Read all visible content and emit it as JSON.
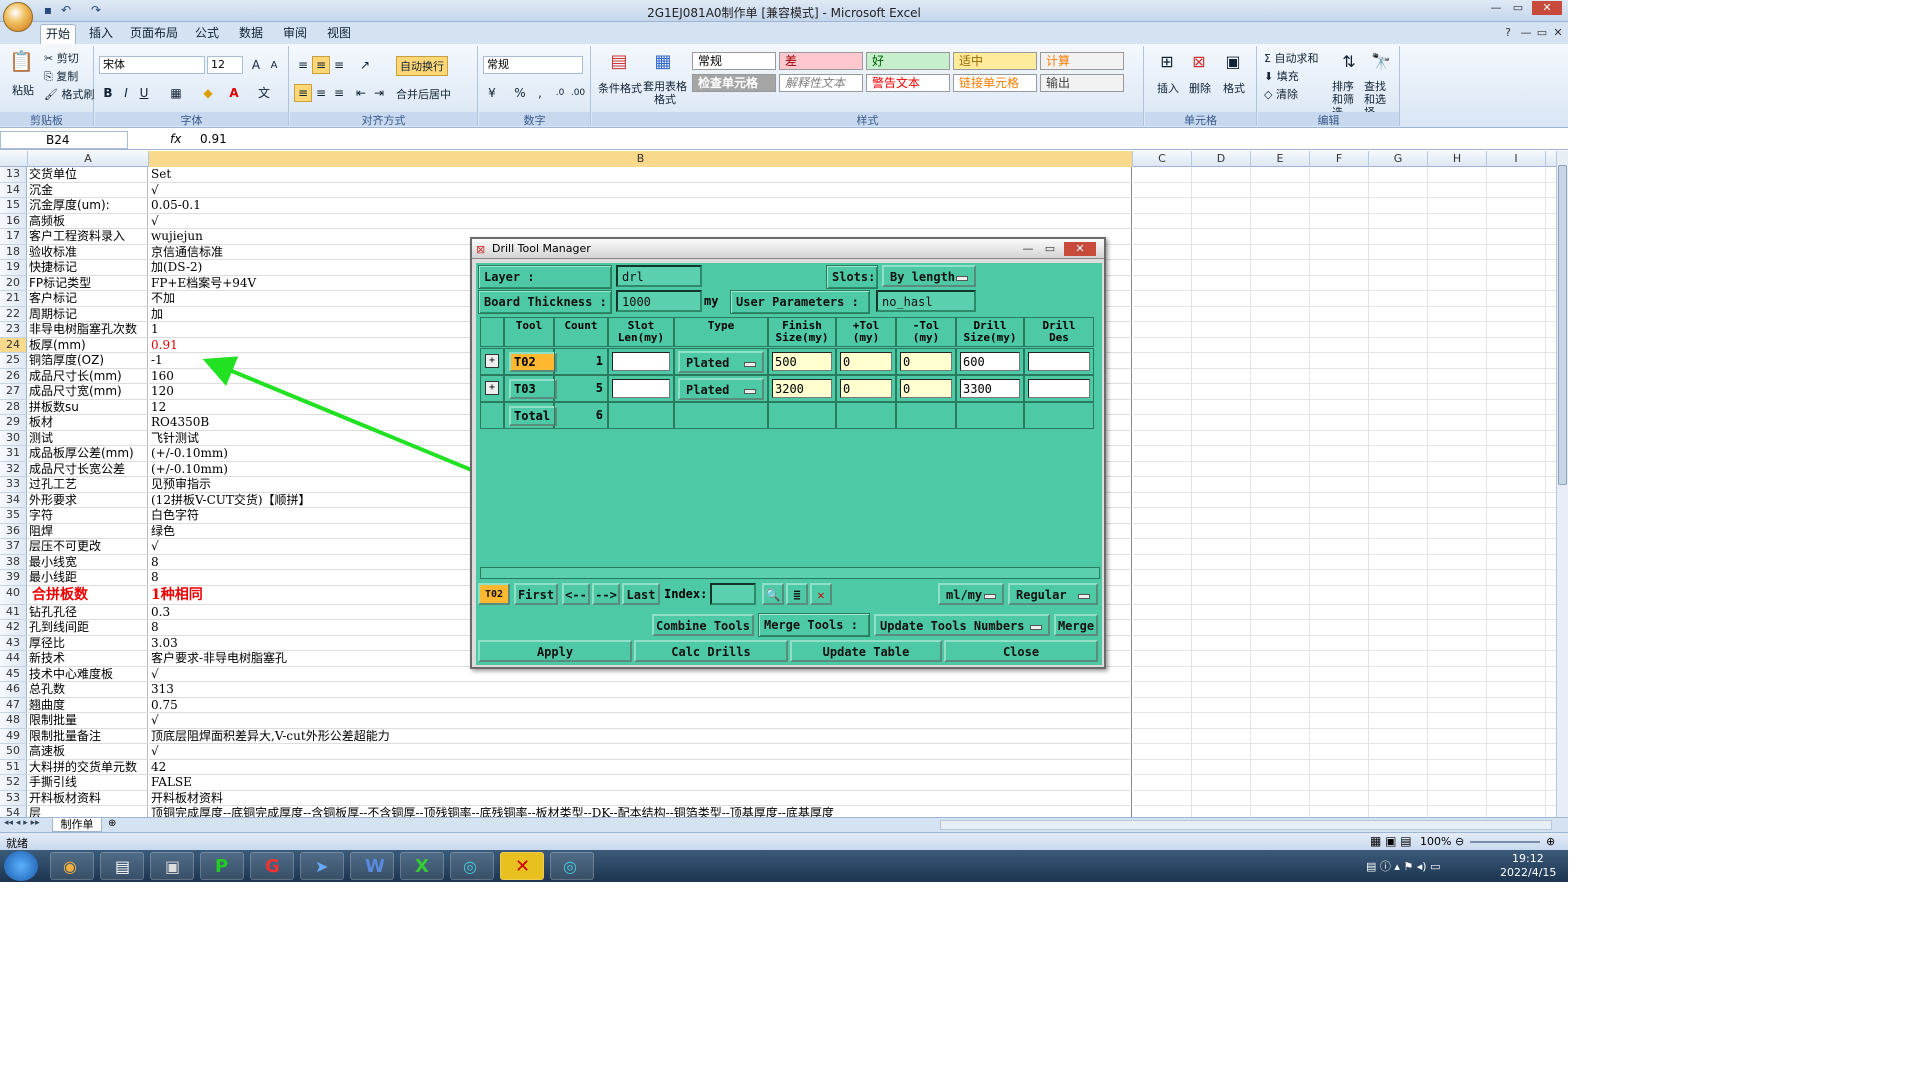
{
  "window": {
    "title": "2G1EJ081A0制作单  [兼容模式] - Microsoft Excel"
  },
  "ribbon": {
    "tabs": [
      "开始",
      "插入",
      "页面布局",
      "公式",
      "数据",
      "审阅",
      "视图"
    ],
    "clipboard": {
      "paste": "粘贴",
      "cut": "剪切",
      "copy": "复制",
      "format_painter": "格式刷",
      "label": "剪贴板"
    },
    "font": {
      "name": "宋体",
      "size": "12",
      "bold": "B",
      "italic": "I",
      "underline": "U",
      "label": "字体"
    },
    "alignment": {
      "wrap": "自动换行",
      "merge": "合并后居中",
      "label": "对齐方式"
    },
    "number": {
      "format": "常规",
      "percent": "%",
      "comma": ",",
      "label": "数字"
    },
    "styles": {
      "conditional": "条件格式",
      "table_format": "套用表格格式",
      "cells": [
        {
          "text": "常规",
          "bg": "#ffffff",
          "color": "#000000"
        },
        {
          "text": "差",
          "bg": "#ffc7ce",
          "color": "#9c0006"
        },
        {
          "text": "好",
          "bg": "#c6efce",
          "color": "#006100"
        },
        {
          "text": "适中",
          "bg": "#ffeb9c",
          "color": "#9c6500"
        },
        {
          "text": "计算",
          "bg": "#f2f2f2",
          "color": "#fa7d00"
        },
        {
          "text": "检查单元格",
          "bg": "#a5a5a5",
          "color": "#ffffff"
        },
        {
          "text": "解释性文本",
          "bg": "#ffffff",
          "color": "#7f7f7f"
        },
        {
          "text": "警告文本",
          "bg": "#ffffff",
          "color": "#ff0000"
        },
        {
          "text": "链接单元格",
          "bg": "#ffffff",
          "color": "#fa7d00"
        },
        {
          "text": "输出",
          "bg": "#f2f2f2",
          "color": "#3f3f3f"
        }
      ],
      "label": "样式"
    },
    "cells_group": {
      "insert": "插入",
      "delete": "删除",
      "format": "格式",
      "label": "单元格"
    },
    "editing": {
      "autosum": "自动求和",
      "fill": "填充",
      "clear": "清除",
      "sort": "排序和筛选",
      "find": "查找和选择",
      "label": "编辑"
    }
  },
  "formula_bar": {
    "name_box": "B24",
    "fx": "fx",
    "value": "0.91"
  },
  "columns": [
    "A",
    "B",
    "C",
    "D",
    "E",
    "F",
    "G",
    "H",
    "I"
  ],
  "rows": [
    {
      "n": "13",
      "a": "交货单位",
      "b": "Set"
    },
    {
      "n": "14",
      "a": "沉金",
      "b": "√"
    },
    {
      "n": "15",
      "a": "沉金厚度(um):",
      "b": "0.05-0.1"
    },
    {
      "n": "16",
      "a": "高频板",
      "b": "√"
    },
    {
      "n": "17",
      "a": "客户工程资料录入",
      "b": "wujiejun"
    },
    {
      "n": "18",
      "a": "验收标准",
      "b": "京信通信标准"
    },
    {
      "n": "19",
      "a": "快捷标记",
      "b": "加(DS-2)"
    },
    {
      "n": "20",
      "a": "FP标记类型",
      "b": "FP+E档案号+94V"
    },
    {
      "n": "21",
      "a": "客户标记",
      "b": "不加"
    },
    {
      "n": "22",
      "a": "周期标记",
      "b": "加"
    },
    {
      "n": "23",
      "a": "非导电树脂塞孔次数",
      "b": "1"
    },
    {
      "n": "24",
      "a": "板厚(mm)",
      "b": "0.91",
      "style": "red"
    },
    {
      "n": "25",
      "a": "铜箔厚度(OZ)",
      "b": "-1"
    },
    {
      "n": "26",
      "a": "成品尺寸长(mm)",
      "b": "160"
    },
    {
      "n": "27",
      "a": "成品尺寸宽(mm)",
      "b": "120"
    },
    {
      "n": "28",
      "a": "拼板数su",
      "b": "12"
    },
    {
      "n": "29",
      "a": "板材",
      "b": "RO4350B"
    },
    {
      "n": "30",
      "a": "测试",
      "b": "飞针测试"
    },
    {
      "n": "31",
      "a": "成品板厚公差(mm)",
      "b": "(+/-0.10mm)"
    },
    {
      "n": "32",
      "a": "成品尺寸长宽公差",
      "b": "(+/-0.10mm)"
    },
    {
      "n": "33",
      "a": "过孔工艺",
      "b": "见预审指示"
    },
    {
      "n": "34",
      "a": "外形要求",
      "b": "(12拼板V-CUT交货)【顺拼】"
    },
    {
      "n": "35",
      "a": "字符",
      "b": "白色字符"
    },
    {
      "n": "36",
      "a": "阻焊",
      "b": "绿色"
    },
    {
      "n": "37",
      "a": "层压不可更改",
      "b": "√"
    },
    {
      "n": "38",
      "a": "最小线宽",
      "b": "8"
    },
    {
      "n": "39",
      "a": "最小线距",
      "b": "8"
    },
    {
      "n": "40",
      "a": "合拼板数",
      "b": "1种相同",
      "style": "bigred"
    },
    {
      "n": "41",
      "a": "钻孔孔径",
      "b": "0.3"
    },
    {
      "n": "42",
      "a": "孔到线间距",
      "b": "8"
    },
    {
      "n": "43",
      "a": "厚径比",
      "b": "3.03"
    },
    {
      "n": "44",
      "a": "新技术",
      "b": "客户要求-非导电树脂塞孔"
    },
    {
      "n": "45",
      "a": "技术中心难度板",
      "b": "√"
    },
    {
      "n": "46",
      "a": "总孔数",
      "b": "313"
    },
    {
      "n": "47",
      "a": "翘曲度",
      "b": "0.75"
    },
    {
      "n": "48",
      "a": "限制批量",
      "b": "√"
    },
    {
      "n": "49",
      "a": "限制批量备注",
      "b": "顶底层阻焊面积差异大,V-cut外形公差超能力"
    },
    {
      "n": "50",
      "a": "高速板",
      "b": "√"
    },
    {
      "n": "51",
      "a": "大料拼的交货单元数",
      "b": "42"
    },
    {
      "n": "52",
      "a": "手撕引线",
      "b": "FALSE"
    },
    {
      "n": "53",
      "a": "开料板材资料",
      "b": "开料板材资料"
    },
    {
      "n": "54",
      "a": "层",
      "b": "顶铜完成厚度--底铜完成厚度--含铜板厚--不含铜厚--顶残铜率--底残铜率--板材类型--DK--配本结构--铜箔类型--顶基厚度--底基厚度"
    }
  ],
  "sheet_tab": "制作单",
  "status": {
    "ready": "就绪",
    "zoom": "100%"
  },
  "taskbar": {
    "time": "19:12",
    "date": "2022/4/15"
  },
  "dialog": {
    "title": "Drill Tool Manager",
    "layer_label": "Layer           :",
    "layer_value": "drl",
    "slots_label": "Slots:",
    "slots_value": "By length",
    "thickness_label": "Board Thickness :",
    "thickness_value": "1000",
    "thickness_unit": "my",
    "user_params_label": "User Parameters :",
    "user_params_value": "no_hasl",
    "headers": [
      "Tool",
      "Count",
      "Slot\nLen(my)",
      "Type",
      "Finish\nSize(my)",
      "+Tol\n(my)",
      "-Tol\n(my)",
      "Drill\nSize(my)",
      "Drill\nDes"
    ],
    "rows": [
      {
        "tool": "T02",
        "count": "1",
        "slot": "",
        "type": "Plated",
        "finish": "500",
        "ptol": "0",
        "mtol": "0",
        "drill": "600",
        "des": ""
      },
      {
        "tool": "T03",
        "count": "5",
        "slot": "",
        "type": "Plated",
        "finish": "3200",
        "ptol": "0",
        "mtol": "0",
        "drill": "3300",
        "des": ""
      }
    ],
    "total_label": "Total",
    "total_count": "6",
    "current_tool": "T02",
    "nav": {
      "first": "First",
      "prev": "<--",
      "next": "-->",
      "last": "Last",
      "index": "Index:"
    },
    "units": "ml/my",
    "mode": "Regular",
    "combine": "Combine Tools",
    "merge_label": "Merge Tools :",
    "update_numbers": "Update Tools Numbers",
    "merge": "Merge",
    "apply": "Apply",
    "calc": "Calc Drills",
    "update_table": "Update Table",
    "close": "Close"
  }
}
